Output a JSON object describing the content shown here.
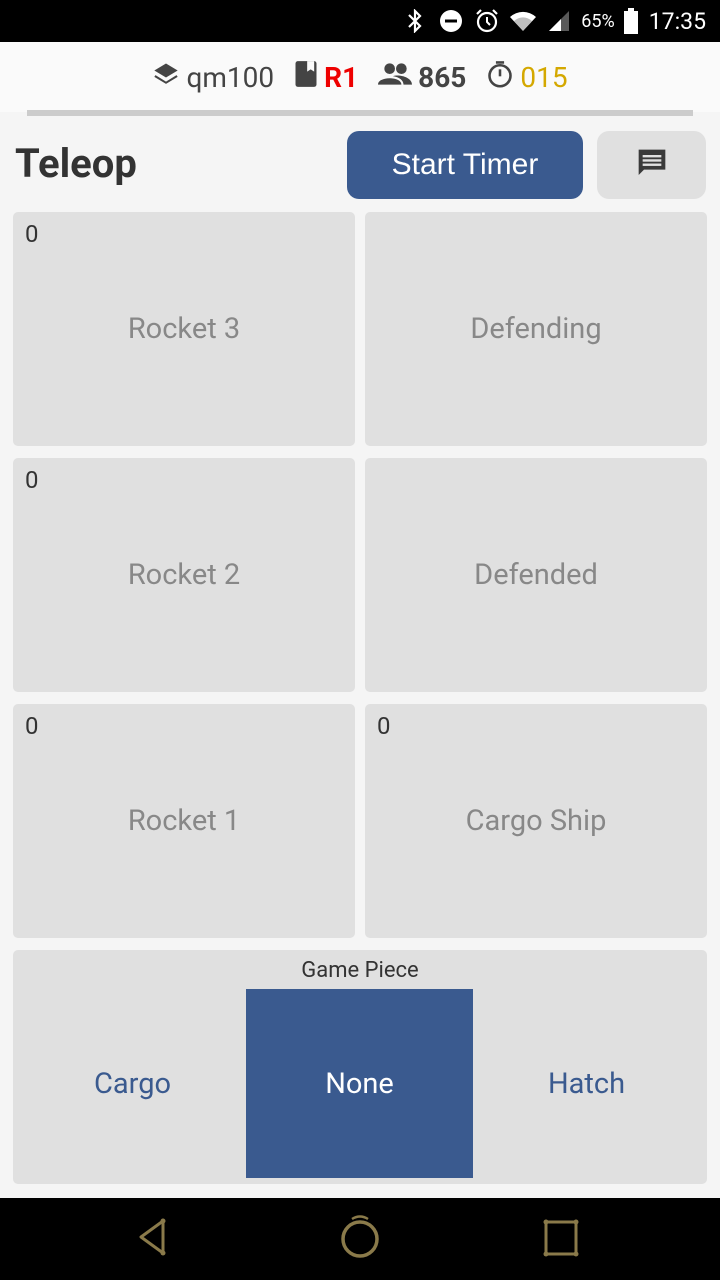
{
  "status_bar": {
    "battery": "65%",
    "time": "17:35"
  },
  "match_info": {
    "match": "qm100",
    "position": "R1",
    "team": "865",
    "timer": "015"
  },
  "header": {
    "title": "Teleop",
    "start_timer_label": "Start Timer"
  },
  "tiles": [
    {
      "label": "Rocket 3",
      "count": "0"
    },
    {
      "label": "Defending",
      "count": ""
    },
    {
      "label": "Rocket 2",
      "count": "0"
    },
    {
      "label": "Defended",
      "count": ""
    },
    {
      "label": "Rocket 1",
      "count": "0"
    },
    {
      "label": "Cargo Ship",
      "count": "0"
    }
  ],
  "game_piece": {
    "label": "Game Piece",
    "options": [
      "Cargo",
      "None",
      "Hatch"
    ],
    "selected": "None"
  },
  "colors": {
    "accent": "#3a5a8f",
    "alliance_red": "#ee0000",
    "timer_gold": "#d4a800",
    "tile_bg": "#e0e0e0"
  },
  "icons": [
    "bluetooth-icon",
    "do-not-disturb-icon",
    "alarm-icon",
    "wifi-icon",
    "signal-icon",
    "battery-icon",
    "layers-icon",
    "bookmark-icon",
    "people-icon",
    "stopwatch-icon",
    "chat-icon",
    "nav-back-icon",
    "nav-home-icon",
    "nav-recents-icon"
  ]
}
